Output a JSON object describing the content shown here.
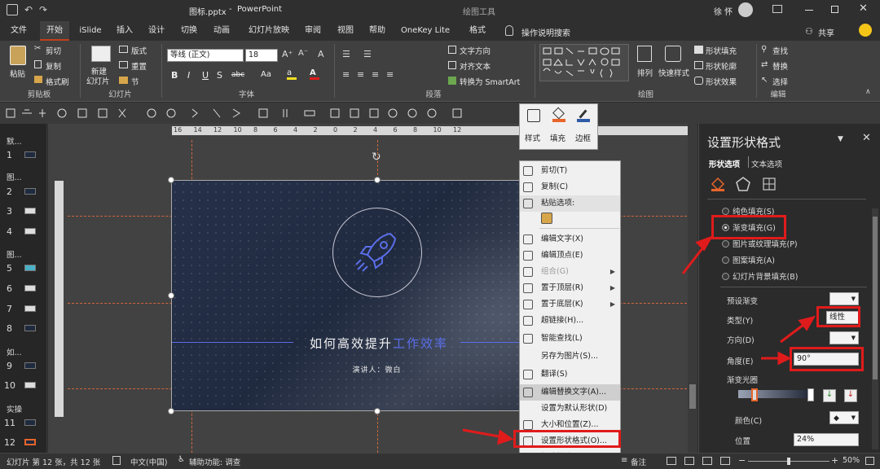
{
  "titlebar": {
    "filename": "图标.pptx",
    "separator": "-",
    "app": "PowerPoint",
    "tools_label": "绘图工具",
    "user": "徐 怀"
  },
  "tabs": [
    "文件",
    "开始",
    "iSlide",
    "插入",
    "设计",
    "切换",
    "动画",
    "幻灯片放映",
    "审阅",
    "视图",
    "帮助",
    "OneKey Lite",
    "格式"
  ],
  "tell_me": "操作说明搜索",
  "share": "共享",
  "ribbon": {
    "clipboard": {
      "paste": "粘贴",
      "cut": "剪切",
      "copy": "复制",
      "format_painter": "格式刷",
      "label": "剪贴板"
    },
    "slides": {
      "new_slide_1": "新建",
      "new_slide_2": "幻灯片",
      "layout": "版式",
      "reset": "重置",
      "section": "节",
      "label": "幻灯片"
    },
    "font": {
      "font_name": "等线 (正文)",
      "font_size": "18",
      "bold": "B",
      "italic": "I",
      "underline": "U",
      "strike": "S",
      "spacing": "abc",
      "case": "Aa",
      "label": "字体"
    },
    "paragraph": {
      "text_direction": "文字方向",
      "align_text": "对齐文本",
      "smartart": "转换为 SmartArt",
      "label": "段落"
    },
    "drawing": {
      "arrange": "排列",
      "quick_styles": "快速样式",
      "fill": "形状填充",
      "outline": "形状轮廓",
      "effects": "形状效果",
      "label": "绘图"
    },
    "editing": {
      "find": "查找",
      "replace": "替换",
      "select": "选择",
      "label": "编辑"
    }
  },
  "ruler": {
    "ticks": [
      "16",
      "14",
      "12",
      "10",
      "8",
      "6",
      "4",
      "2",
      "0",
      "2",
      "4",
      "6",
      "8",
      "10",
      "12"
    ]
  },
  "thumbs": {
    "sections": [
      "默...",
      "图...",
      "图...",
      "如...",
      "实操"
    ],
    "numbers": [
      "1",
      "2",
      "3",
      "4",
      "5",
      "6",
      "7",
      "8",
      "9",
      "10",
      "11",
      "12"
    ]
  },
  "slide": {
    "title_white": "如何高效提升",
    "title_blue": "工作效率",
    "presenter": "演讲人：微白"
  },
  "minitoolbar": {
    "style": "样式",
    "fill": "填充",
    "outline": "边框"
  },
  "context_menu": [
    {
      "label": "剪切(T)",
      "icon": "scissors-icon",
      "disabled": false,
      "arrow": false
    },
    {
      "label": "复制(C)",
      "icon": "copy-icon",
      "disabled": false,
      "arrow": false
    },
    {
      "label": "粘贴选项:",
      "icon": "paste-icon",
      "disabled": false,
      "arrow": false
    },
    {
      "label": "",
      "icon": "paste-option-icon",
      "disabled": false,
      "arrow": false
    },
    {
      "label": "编辑文字(X)",
      "icon": "edit-text-icon",
      "disabled": false,
      "arrow": false
    },
    {
      "label": "编辑顶点(E)",
      "icon": "edit-points-icon",
      "disabled": false,
      "arrow": false
    },
    {
      "label": "组合(G)",
      "icon": "group-icon",
      "disabled": true,
      "arrow": true
    },
    {
      "label": "置于顶层(R)",
      "icon": "bring-front-icon",
      "disabled": false,
      "arrow": true
    },
    {
      "label": "置于底层(K)",
      "icon": "send-back-icon",
      "disabled": false,
      "arrow": true
    },
    {
      "label": "超链接(H)...",
      "icon": "link-icon",
      "disabled": false,
      "arrow": false
    },
    {
      "label": "智能查找(L)",
      "icon": "smart-lookup-icon",
      "disabled": false,
      "arrow": false
    },
    {
      "label": "另存为图片(S)...",
      "icon": "",
      "disabled": false,
      "arrow": false
    },
    {
      "label": "翻译(S)",
      "icon": "translate-icon",
      "disabled": false,
      "arrow": false
    },
    {
      "label": "编辑替换文字(A)...",
      "icon": "alt-text-icon",
      "disabled": false,
      "arrow": false
    },
    {
      "label": "设置为默认形状(D)",
      "icon": "",
      "disabled": false,
      "arrow": false
    },
    {
      "label": "大小和位置(Z)...",
      "icon": "size-icon",
      "disabled": false,
      "arrow": false
    },
    {
      "label": "设置形状格式(O)...",
      "icon": "format-shape-icon",
      "disabled": false,
      "arrow": false
    },
    {
      "label": "新建批注(M)",
      "icon": "comment-icon",
      "disabled": false,
      "arrow": false
    }
  ],
  "pane": {
    "title": "设置形状格式",
    "tab_shape": "形状选项",
    "tab_text": "文本选项",
    "fill_options": [
      "纯色填充(S)",
      "渐变填充(G)",
      "图片或纹理填充(P)",
      "图案填充(A)",
      "幻灯片背景填充(B)"
    ],
    "selected_fill": 1,
    "preset": "预设渐变",
    "type_label": "类型(Y)",
    "type_value": "线性",
    "direction_label": "方向(D)",
    "angle_label": "角度(E)",
    "angle_value": "90°",
    "stops_label": "渐变光圈",
    "color_label": "颜色(C)",
    "position_label": "位置",
    "position_value": "24%"
  },
  "status": {
    "slide_info": "幻灯片 第 12 张，共 12 张",
    "lang": "中文(中国)",
    "accessibility": "辅助功能: 调查",
    "notes": "备注",
    "zoom": "50%"
  },
  "colors": {
    "accent": "#c43e1c",
    "highlight": "#e01b1b",
    "slide_blue": "#5a6ee8"
  }
}
